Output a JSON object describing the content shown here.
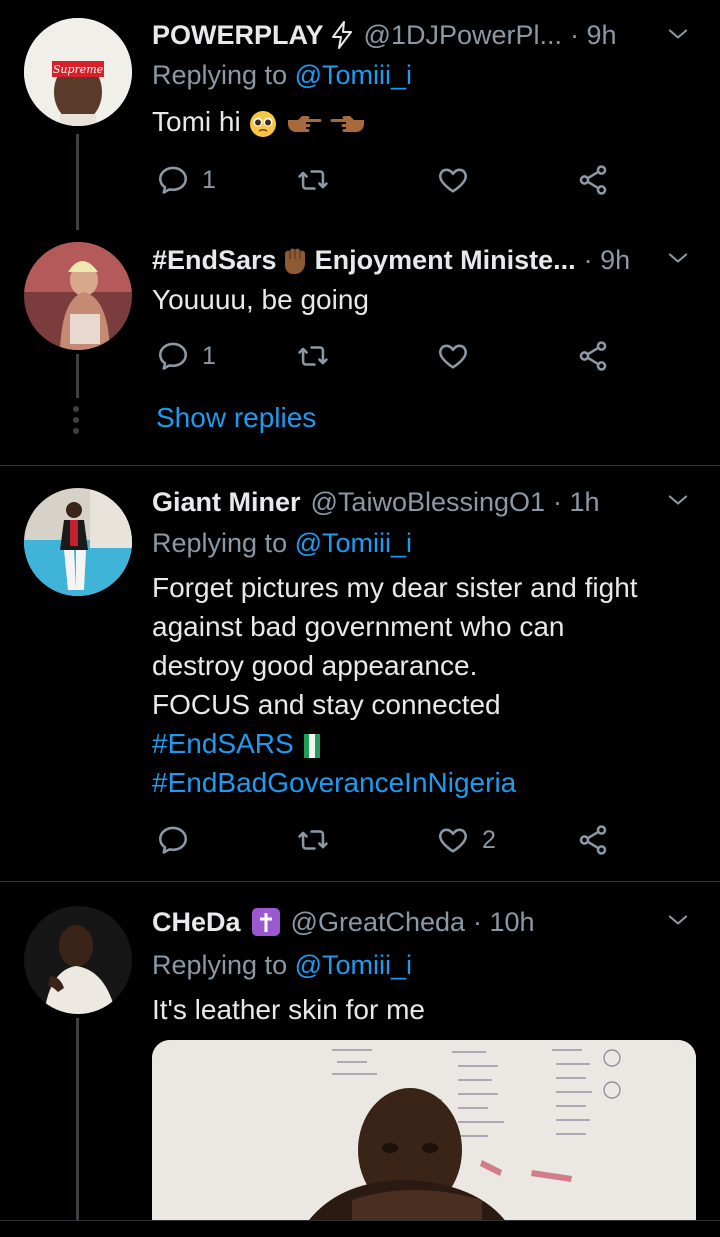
{
  "tweets": [
    {
      "name": "POWERPLAY",
      "handle": "@1DJPowerPl...",
      "time": "· 9h",
      "replying_prefix": "Replying to ",
      "replying_to": "@Tomiii_i",
      "text": "Tomi hi",
      "avatar_label": "Supreme",
      "replies": "1",
      "likes": ""
    },
    {
      "name_prefix": "#EndSars",
      "name_suffix": "Enjoyment Ministe...",
      "time": "· 9h",
      "text": "Youuuu, be going",
      "replies": "1",
      "likes": "",
      "show_replies": "Show replies"
    },
    {
      "name": "Giant Miner",
      "handle": "@TaiwoBlessingO1",
      "time": "· 1h",
      "replying_prefix": "Replying to ",
      "replying_to": "@Tomiii_i",
      "text_lines": [
        "Forget pictures my dear sister and fight",
        "against bad government who can",
        "destroy good appearance.",
        "FOCUS and stay connected"
      ],
      "hashtag1": "#EndSARS",
      "hashtag2": "#EndBadGoveranceInNigeria",
      "replies": "",
      "likes": "2"
    },
    {
      "name": "CHeDa",
      "handle": "@GreatCheda",
      "time": "· 10h",
      "replying_prefix": "Replying to ",
      "replying_to": "@Tomiii_i",
      "text": "It's leather skin for me"
    }
  ],
  "icons": [
    "reply-icon",
    "retweet-icon",
    "like-icon",
    "share-icon",
    "chevron-down-icon",
    "lightning-icon",
    "cross-badge-icon"
  ],
  "colors": {
    "background": "#000000",
    "text": "#e7e9ea",
    "muted": "#8b98a5",
    "link": "#1d9bf0",
    "divider": "#2f3336"
  }
}
